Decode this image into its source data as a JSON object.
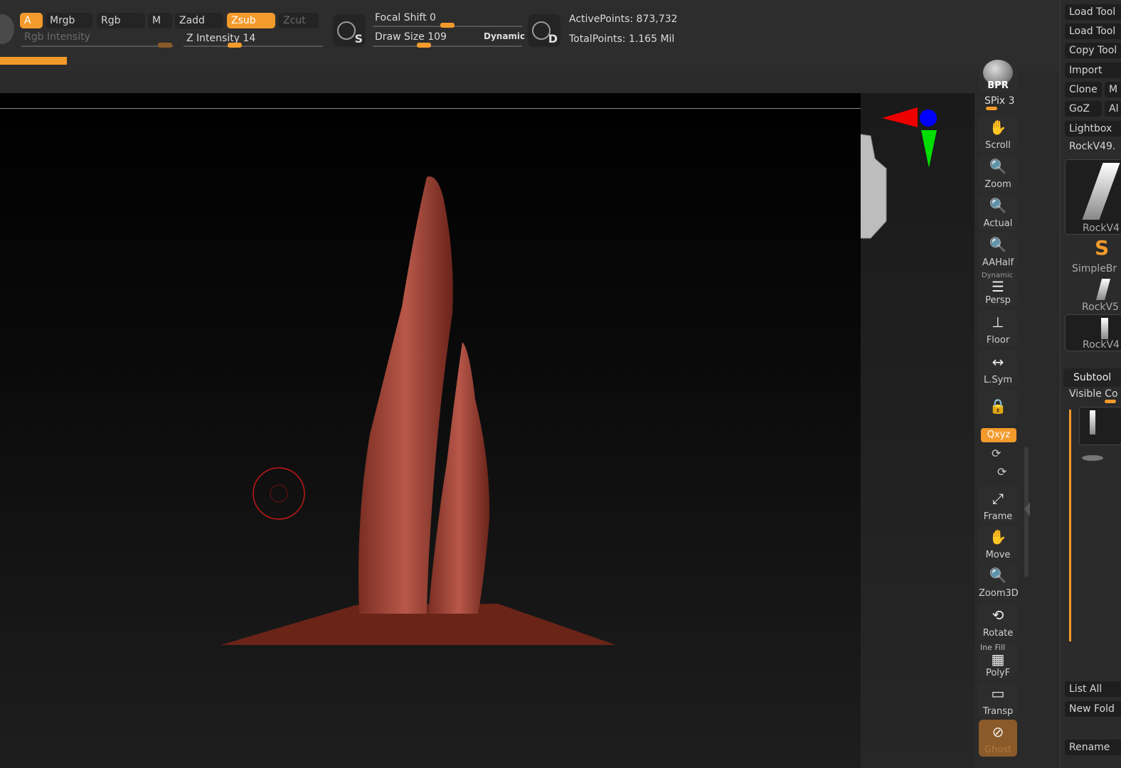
{
  "topbar": {
    "buttons": {
      "a": "A",
      "mrgb": "Mrgb",
      "rgb": "Rgb",
      "m": "M",
      "zadd": "Zadd",
      "zsub": "Zsub",
      "zcut": "Zcut"
    },
    "rgb_intensity_label": "Rgb Intensity",
    "z_intensity_label": "Z Intensity 14",
    "focal_shift_label": "Focal Shift 0",
    "draw_size_label": "Draw Size 109",
    "dynamic_label": "Dynamic",
    "brush_s_letter": "S",
    "brush_d_letter": "D",
    "active_points": "ActivePoints: 873,732",
    "total_points": "TotalPoints: 1.165 Mil"
  },
  "shelf": {
    "bpr": "BPR",
    "spix": "SPix 3",
    "items": [
      "Scroll",
      "Zoom",
      "Actual",
      "AAHalf",
      "Persp",
      "Floor",
      "L.Sym",
      "",
      "Frame",
      "Move",
      "Zoom3D",
      "Rotate",
      "PolyF",
      "Transp",
      "Ghost"
    ],
    "dynamic_tag": "Dynamic",
    "xyz": "Qxyz",
    "line_fill": "Ine Fill"
  },
  "tool_tray": {
    "load_tool": "Load Tool",
    "load_tool2": "Load Tool",
    "copy_tool": "Copy Tool",
    "import": "Import",
    "clone": "Clone",
    "m": "M",
    "goz": "GoZ",
    "all": "Al",
    "lightbox": "Lightbox",
    "current_tool": "RockV49.",
    "thumbs": [
      "RockV4",
      "SimpleBr",
      "RockV5",
      "RockV4"
    ],
    "subtool_header": "Subtool",
    "visible_count": "Visible Co",
    "list_all": "List All",
    "new_folder": "New Fold",
    "rename": "Rename"
  }
}
